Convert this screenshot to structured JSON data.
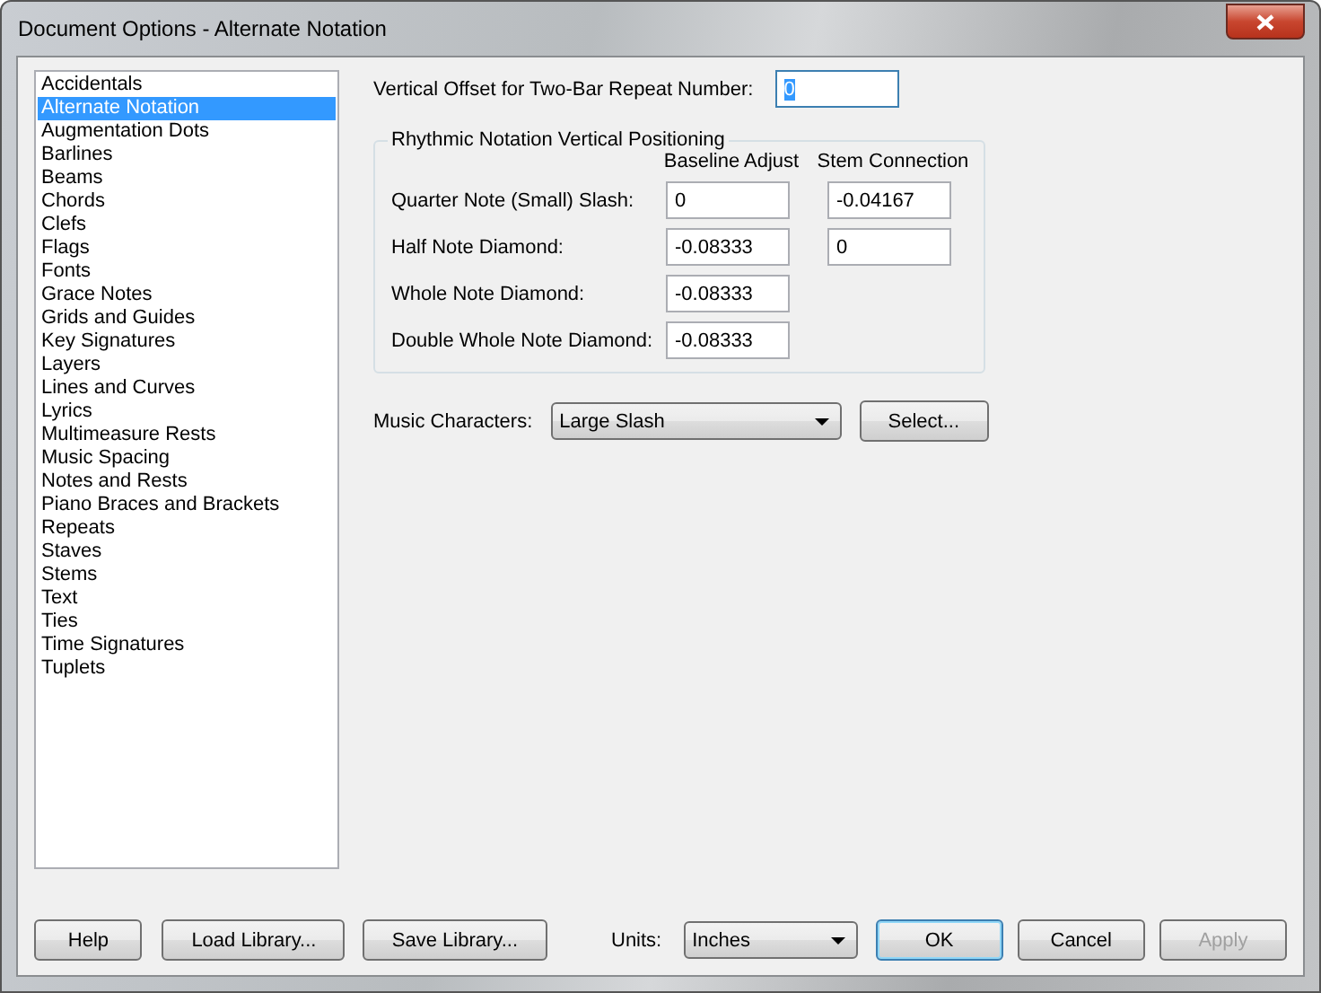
{
  "window": {
    "title": "Document Options - Alternate Notation"
  },
  "categories": [
    {
      "label": "Accidentals",
      "selected": false
    },
    {
      "label": "Alternate Notation",
      "selected": true
    },
    {
      "label": "Augmentation Dots",
      "selected": false
    },
    {
      "label": "Barlines",
      "selected": false
    },
    {
      "label": "Beams",
      "selected": false
    },
    {
      "label": "Chords",
      "selected": false
    },
    {
      "label": "Clefs",
      "selected": false
    },
    {
      "label": "Flags",
      "selected": false
    },
    {
      "label": "Fonts",
      "selected": false
    },
    {
      "label": "Grace Notes",
      "selected": false
    },
    {
      "label": "Grids and Guides",
      "selected": false
    },
    {
      "label": "Key Signatures",
      "selected": false
    },
    {
      "label": "Layers",
      "selected": false
    },
    {
      "label": "Lines and Curves",
      "selected": false
    },
    {
      "label": "Lyrics",
      "selected": false
    },
    {
      "label": "Multimeasure Rests",
      "selected": false
    },
    {
      "label": "Music Spacing",
      "selected": false
    },
    {
      "label": "Notes and Rests",
      "selected": false
    },
    {
      "label": "Piano Braces and Brackets",
      "selected": false
    },
    {
      "label": "Repeats",
      "selected": false
    },
    {
      "label": "Staves",
      "selected": false
    },
    {
      "label": "Stems",
      "selected": false
    },
    {
      "label": "Text",
      "selected": false
    },
    {
      "label": "Ties",
      "selected": false
    },
    {
      "label": "Time Signatures",
      "selected": false
    },
    {
      "label": "Tuplets",
      "selected": false
    }
  ],
  "repeat_offset": {
    "label": "Vertical Offset for Two-Bar Repeat Number:",
    "value": "0",
    "text_selected": true
  },
  "rhythmic_group": {
    "title": "Rhythmic Notation Vertical Positioning",
    "columns": [
      "Baseline Adjust",
      "Stem Connection"
    ],
    "rows": [
      {
        "label": "Quarter Note (Small) Slash:",
        "baseline": "0",
        "stem": "-0.04167"
      },
      {
        "label": "Half Note Diamond:",
        "baseline": "-0.08333",
        "stem": "0"
      },
      {
        "label": "Whole Note Diamond:",
        "baseline": "-0.08333"
      },
      {
        "label": "Double Whole Note Diamond:",
        "baseline": "-0.08333"
      }
    ]
  },
  "music_characters": {
    "label": "Music Characters:",
    "value": "Large Slash"
  },
  "select_button": {
    "label": "Select..."
  },
  "left_buttons": [
    {
      "label": "Help"
    },
    {
      "label": "Load Library..."
    },
    {
      "label": "Save Library..."
    }
  ],
  "units": {
    "label": "Units:",
    "value": "Inches"
  },
  "right_buttons": [
    {
      "label": "OK",
      "default": true,
      "disabled": false
    },
    {
      "label": "Cancel",
      "default": false,
      "disabled": false
    },
    {
      "label": "Apply",
      "default": false,
      "disabled": true
    }
  ]
}
